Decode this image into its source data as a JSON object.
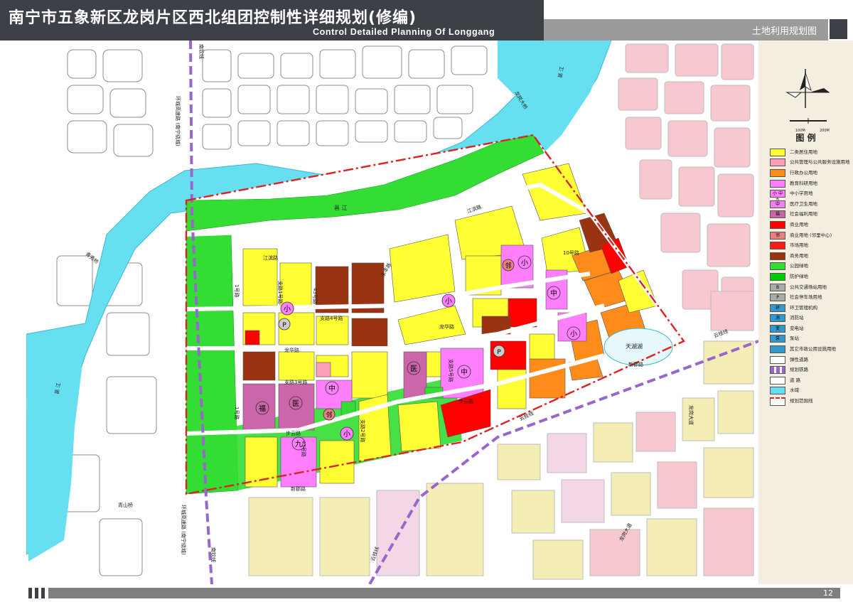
{
  "header": {
    "title_cn": "南宁市五象新区龙岗片区西北组团控制性详细规划(修编)",
    "title_en": "Control Detailed Planning Of Longgang",
    "subtitle": "土地利用规划图"
  },
  "footer": {
    "page_number": "12"
  },
  "scale": {
    "label_a": "100M",
    "label_b": "200M"
  },
  "legend": {
    "title": "图  例",
    "items": [
      {
        "label": "二类居住用地",
        "color": "#ffff33",
        "symbol": ""
      },
      {
        "label": "公共管理与公共服务设施用地",
        "color": "#ff9fb6",
        "symbol": ""
      },
      {
        "label": "行政办公用地",
        "color": "#ff8c1a",
        "symbol": ""
      },
      {
        "label": "教育科研用地",
        "color": "#ff7fff",
        "symbol": ""
      },
      {
        "label": "中小学用地",
        "color": "#ff7fff",
        "symbol": "小 中 九"
      },
      {
        "label": "医疗卫生用地",
        "color": "#ee82ee",
        "symbol": "中"
      },
      {
        "label": "社会福利用地",
        "color": "#cc66aa",
        "symbol": "福"
      },
      {
        "label": "商业用地",
        "color": "#ff0000",
        "symbol": ""
      },
      {
        "label": "商业用地 (邻里中心)",
        "color": "#e88080",
        "symbol": "邻"
      },
      {
        "label": "市场用地",
        "color": "#ff1a1a",
        "symbol": ""
      },
      {
        "label": "商务用地",
        "color": "#993311",
        "symbol": ""
      },
      {
        "label": "公园绿地",
        "color": "#33dd33",
        "symbol": ""
      },
      {
        "label": "防护绿地",
        "color": "#00cc00",
        "symbol": ""
      },
      {
        "label": "公共交通场站用地",
        "color": "#aaaaaa",
        "symbol": "B"
      },
      {
        "label": "社会停车场用地",
        "color": "#aaaaaa",
        "symbol": "P"
      },
      {
        "label": "环卫管理机构",
        "color": "#3399cc",
        "symbol": "环"
      },
      {
        "label": "消防站",
        "color": "#3399cc",
        "symbol": "消"
      },
      {
        "label": "变电站",
        "color": "#3399cc",
        "symbol": "变"
      },
      {
        "label": "泵站",
        "color": "#3399cc",
        "symbol": "泵"
      },
      {
        "label": "其它市政公用设施用地",
        "color": "#3399cc",
        "symbol": ""
      },
      {
        "label": "弹性道路",
        "color": "#ffffff",
        "symbol": ""
      },
      {
        "label": "规划铁路",
        "color": "#9966cc",
        "symbol": ""
      },
      {
        "label": "道  路",
        "color": "#ffffff",
        "symbol": ""
      },
      {
        "label": "水域",
        "color": "#66ddee",
        "symbol": ""
      },
      {
        "label": "规划范围线",
        "color": "#dd2222",
        "symbol": ""
      }
    ]
  },
  "map": {
    "rivers": [
      "邕  江",
      "邕  江",
      "邕  江"
    ],
    "lake": "天湖湖",
    "roads": {
      "huanchengA": "环城高速路 (南宁绕城)",
      "huanchengB": "环城高速路 (南宁绕城)",
      "nanqinA": "南钦线",
      "nanqinB": "南钦线",
      "longgang_bridge": "龙岗大桥",
      "qingxiu_bridge": "青秀桥",
      "qingshan_bridge": "青山桥",
      "jiangbin": "江滨路",
      "jiangbin2": "江滨路",
      "zhilu1": "支路1号路",
      "r43a": "43号路",
      "r43b": "43号路",
      "zhi4": "支路4号路",
      "r1a": "1号路",
      "r1b": "1号路",
      "longhua": "龙华路",
      "longhua2": "龙华路",
      "zhilu3": "支路3号路",
      "buyun": "步云路",
      "buyun2": "步云路",
      "xinjun": "新郡路",
      "xinjun2": "新郡路",
      "yunjie1": "云桂线",
      "yunjie2": "云桂线",
      "yunjie3": "云桂线",
      "longgang_ave": "龙岗大道",
      "longgang_ave2": "龙岗大道",
      "r10": "10号路",
      "zhilu2": "支路2号路",
      "zhilu5": "支路5号路",
      "yongfeng": "永丰路"
    },
    "symbols": {
      "xiao": "小",
      "zhong": "中",
      "jiu": "九",
      "fu": "福",
      "lin": "邻",
      "p": "P",
      "yi": "医"
    }
  }
}
